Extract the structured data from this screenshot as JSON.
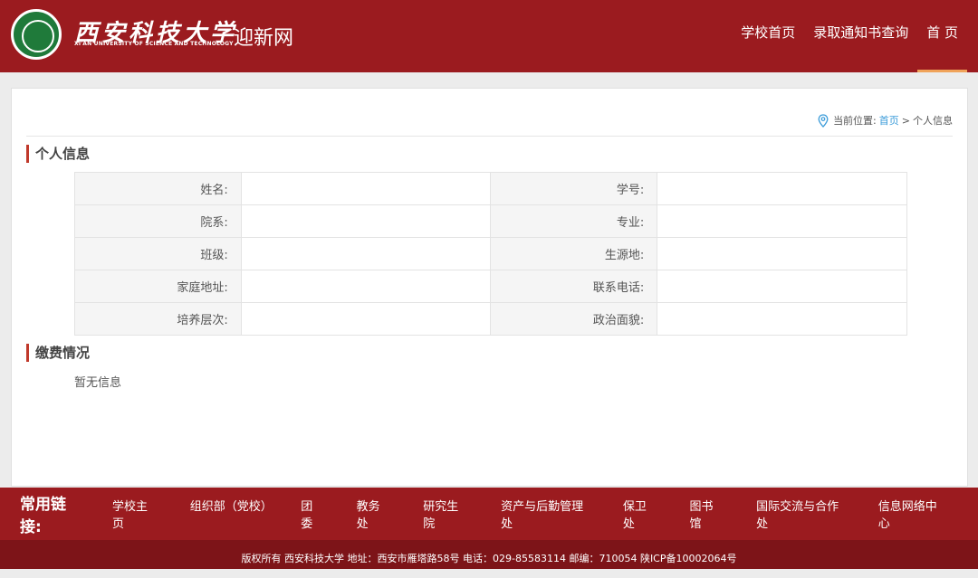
{
  "header": {
    "school_name": "西安科技大学",
    "school_en": "XI'AN UNIVERSITY OF SCIENCE AND TECHNOLOGY",
    "site_name": "迎新网",
    "nav": [
      "学校首页",
      "录取通知书查询",
      "首 页"
    ]
  },
  "breadcrumb": {
    "prefix": "当前位置:",
    "home": "首页",
    "sep": ">",
    "current": "个人信息"
  },
  "personal": {
    "title": "个人信息",
    "rows": [
      {
        "l1": "姓名:",
        "v1": "",
        "l2": "学号:",
        "v2": ""
      },
      {
        "l1": "院系:",
        "v1": "",
        "l2": "专业:",
        "v2": ""
      },
      {
        "l1": "班级:",
        "v1": "",
        "l2": "生源地:",
        "v2": ""
      },
      {
        "l1": "家庭地址:",
        "v1": "",
        "l2": "联系电话:",
        "v2": ""
      },
      {
        "l1": "培养层次:",
        "v1": "",
        "l2": "政治面貌:",
        "v2": ""
      }
    ]
  },
  "payment": {
    "title": "缴费情况",
    "empty_text": "暂无信息"
  },
  "footer": {
    "links_title": "常用链接:",
    "links": [
      "学校主页",
      "组织部（党校）",
      "团委",
      "教务处",
      "研究生院",
      "资产与后勤管理处",
      "保卫处",
      "图书馆",
      "国际交流与合作处",
      "信息网络中心"
    ],
    "copyright": "版权所有 西安科技大学 地址：西安市雁塔路58号 电话：029-85583114 邮编：710054 陕ICP备10002064号"
  },
  "colors": {
    "brand_red": "#9b1b1f",
    "logo_green": "#1f7a3a",
    "link_blue": "#3a9bd9"
  }
}
